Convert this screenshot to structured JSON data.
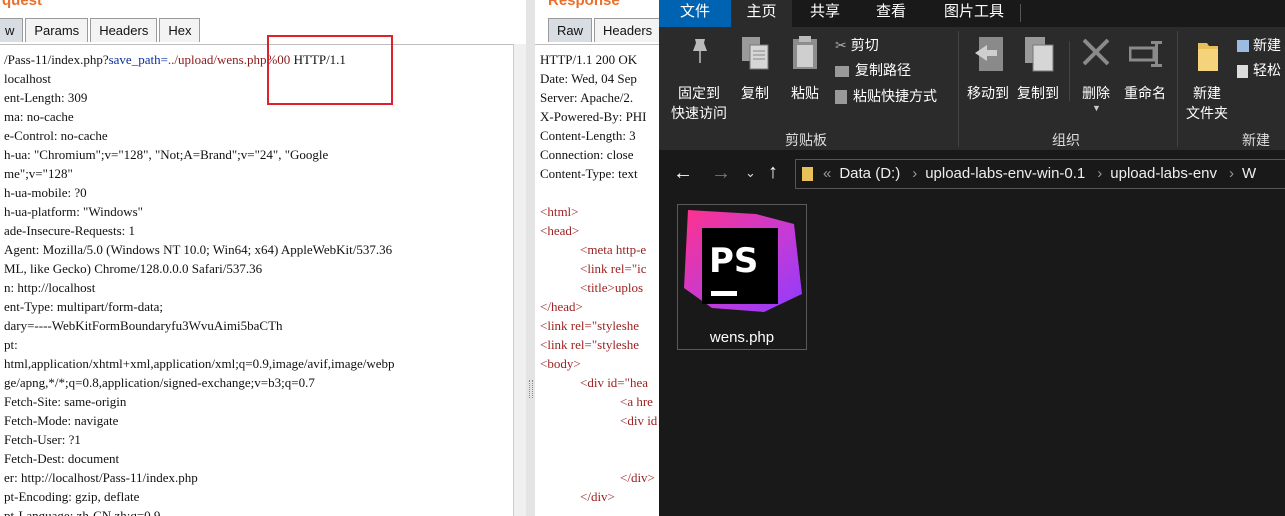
{
  "request": {
    "title": "quest",
    "tabs": [
      "w",
      "Params",
      "Headers",
      "Hex"
    ],
    "first_line": {
      "a": "/Pass-11/index.php?",
      "b": "save_path=",
      "c": "../upload/wens.php%00",
      "d": " HTTP/1.1"
    },
    "lines": [
      "localhost",
      "ent-Length: 309",
      "ma: no-cache",
      "e-Control: no-cache",
      "h-ua: \"Chromium\";v=\"128\", \"Not;A=Brand\";v=\"24\", \"Google",
      "me\";v=\"128\"",
      "h-ua-mobile: ?0",
      "h-ua-platform: \"Windows\"",
      "ade-Insecure-Requests: 1",
      "Agent: Mozilla/5.0 (Windows NT 10.0; Win64; x64) AppleWebKit/537.36",
      "ML, like Gecko) Chrome/128.0.0.0 Safari/537.36",
      "n: http://localhost",
      "ent-Type: multipart/form-data;",
      "dary=----WebKitFormBoundaryfu3WvuAimi5baCTh",
      "pt:",
      "html,application/xhtml+xml,application/xml;q=0.9,image/avif,image/webp",
      "ge/apng,*/*;q=0.8,application/signed-exchange;v=b3;q=0.7",
      "Fetch-Site: same-origin",
      "Fetch-Mode: navigate",
      "Fetch-User: ?1",
      "Fetch-Dest: document",
      "er: http://localhost/Pass-11/index.php",
      "pt-Encoding: gzip, deflate",
      "pt-Language: zh-CN,zh;q=0.9"
    ]
  },
  "response": {
    "title": "Response",
    "tabs": [
      "Raw",
      "Headers"
    ],
    "headers": [
      "HTTP/1.1 200 OK",
      "Date: Wed, 04 Sep",
      "Server: Apache/2.",
      "X-Powered-By: PHI",
      "Content-Length: 3",
      "Connection: close",
      "Content-Type: text"
    ],
    "html": [
      {
        "indent": 0,
        "text": "<html>"
      },
      {
        "indent": 0,
        "text": "<head>"
      },
      {
        "indent": 1,
        "text": "<meta http-e"
      },
      {
        "indent": 1,
        "text": "<link rel=\"ic"
      },
      {
        "indent": 1,
        "text": "<title>uplos"
      },
      {
        "indent": 0,
        "text": "</head>"
      },
      {
        "indent": 0,
        "text": "<link rel=\"styleshe"
      },
      {
        "indent": 0,
        "text": "<link rel=\"styleshe"
      },
      {
        "indent": 0,
        "text": "<body>"
      },
      {
        "indent": 1,
        "text": "<div id=\"hea"
      },
      {
        "indent": 2,
        "text": "<a hre"
      },
      {
        "indent": 2,
        "text": "<div id"
      },
      {
        "indent": 2,
        "text": ""
      },
      {
        "indent": 2,
        "text": ""
      },
      {
        "indent": 2,
        "text": "</div>"
      },
      {
        "indent": 1,
        "text": "</div>"
      }
    ]
  },
  "explorer": {
    "ribbon_tabs": [
      "文件",
      "主页",
      "共享",
      "查看",
      "图片工具"
    ],
    "pin_label_1": "固定到",
    "pin_label_2": "快速访问",
    "copy_label": "复制",
    "paste_label": "粘贴",
    "cut_label": "剪切",
    "copy_path_label": "复制路径",
    "paste_shortcut_label": "粘贴快捷方式",
    "move_to_label": "移动到",
    "copy_to_label": "复制到",
    "delete_label": "删除",
    "rename_label": "重命名",
    "new_folder_label_1": "新建",
    "new_folder_label_2": "文件夹",
    "new_item_label": "新建",
    "easy_access_label": "轻松",
    "group_clipboard": "剪贴板",
    "group_organize": "组织",
    "group_new": "新建",
    "breadcrumb": [
      "Data (D:)",
      "upload-labs-env-win-0.1",
      "upload-labs-env",
      "W"
    ],
    "file": {
      "name": "wens.php",
      "icon": "phpstorm-icon"
    },
    "colors": {
      "accent": "#0063b1",
      "highlight": "#e0202a",
      "ps_pink": "#ff318c",
      "ps_purple": "#8f3bff"
    }
  }
}
